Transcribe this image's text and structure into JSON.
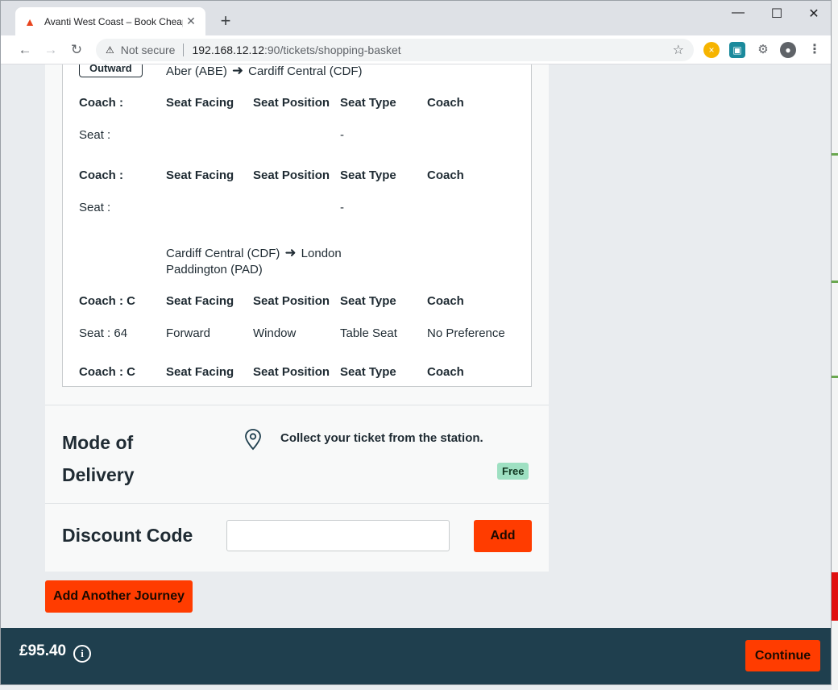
{
  "browser": {
    "tab_title": "Avanti West Coast – Book Cheap",
    "tab_close": "✕",
    "new_tab": "+",
    "url_security": "Not secure",
    "url_host": "192.168.12.12",
    "url_path": ":90/tickets/shopping-basket",
    "window_controls": {
      "minimize": "—",
      "maximize": "☐",
      "close": "✕"
    }
  },
  "journey": {
    "outward_badge": "Outward",
    "legs": [
      {
        "from": "Aber (ABE)",
        "to": "Cardiff Central (CDF)",
        "seats": [
          {
            "coach_label": "Coach :",
            "headers": [
              "Seat Facing",
              "Seat Position",
              "Seat Type",
              "Coach"
            ],
            "seat_label": "Seat :",
            "facing": "",
            "position": "",
            "type": "-",
            "coach_pref": ""
          },
          {
            "coach_label": "Coach :",
            "headers": [
              "Seat Facing",
              "Seat Position",
              "Seat Type",
              "Coach"
            ],
            "seat_label": "Seat :",
            "facing": "",
            "position": "",
            "type": "-",
            "coach_pref": ""
          }
        ]
      },
      {
        "from": "Cardiff Central (CDF)",
        "to_line1": "London",
        "to_line2": "Paddington (PAD)",
        "seats": [
          {
            "coach_label": "Coach : C",
            "headers": [
              "Seat Facing",
              "Seat Position",
              "Seat Type",
              "Coach"
            ],
            "seat_label": "Seat : 64",
            "facing": "Forward",
            "position": "Window",
            "type": "Table Seat",
            "coach_pref": "No Preference"
          },
          {
            "coach_label": "Coach : C",
            "headers": [
              "Seat Facing",
              "Seat Position",
              "Seat Type",
              "Coach"
            ]
          }
        ]
      }
    ]
  },
  "delivery": {
    "title_line1": "Mode of",
    "title_line2": "Delivery",
    "message": "Collect your ticket from the station.",
    "price_badge": "Free"
  },
  "discount": {
    "title": "Discount Code",
    "input_value": "",
    "input_placeholder": "",
    "add_label": "Add"
  },
  "add_journey_label": "Add Another Journey",
  "footer": {
    "total": "£95.40",
    "info_glyph": "i",
    "continue_label": "Continue"
  },
  "colors": {
    "accent": "#ff3c00",
    "footer_bg": "#1f3f4e",
    "free_badge": "#9ee0c2"
  }
}
